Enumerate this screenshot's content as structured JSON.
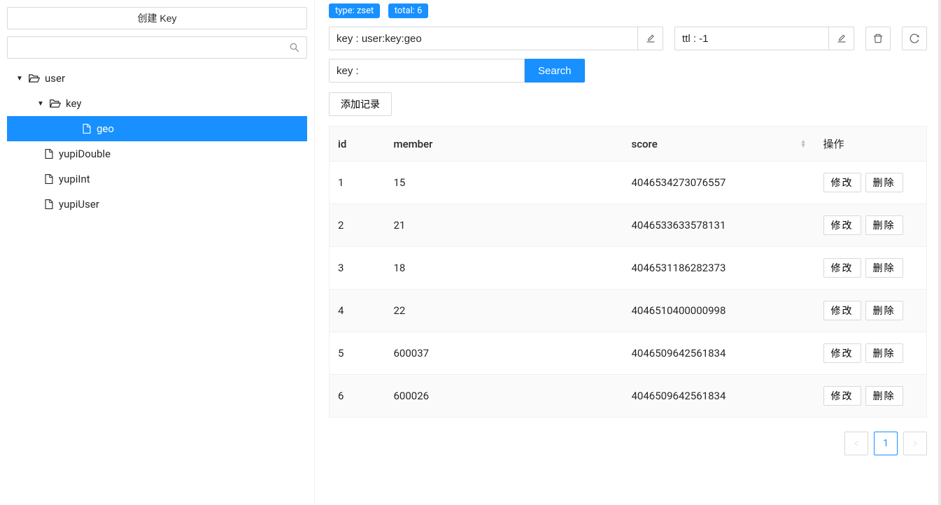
{
  "sidebar": {
    "create_label": "创建 Key",
    "search_placeholder": "",
    "tree": [
      {
        "label": "user",
        "type": "folder",
        "expanded": true,
        "level": 0
      },
      {
        "label": "key",
        "type": "folder",
        "expanded": true,
        "level": 1
      },
      {
        "label": "geo",
        "type": "file",
        "selected": true,
        "level": 2
      },
      {
        "label": "yupiDouble",
        "type": "file",
        "level": 1
      },
      {
        "label": "yupiInt",
        "type": "file",
        "level": 1
      },
      {
        "label": "yupiUser",
        "type": "file",
        "level": 1
      }
    ]
  },
  "main": {
    "type_tag": "type: zset",
    "total_tag": "total: 6",
    "key_value": "key : user:key:geo",
    "ttl_value": "ttl : -1",
    "search_prefix": "key : ",
    "search_button": "Search",
    "add_record": "添加记录",
    "columns": {
      "id": "id",
      "member": "member",
      "score": "score",
      "action": "操作"
    },
    "rows": [
      {
        "id": "1",
        "member": "15",
        "score": "4046534273076557"
      },
      {
        "id": "2",
        "member": "21",
        "score": "4046533633578131"
      },
      {
        "id": "3",
        "member": "18",
        "score": "4046531186282373"
      },
      {
        "id": "4",
        "member": "22",
        "score": "4046510400000998"
      },
      {
        "id": "5",
        "member": "600037",
        "score": "4046509642561834"
      },
      {
        "id": "6",
        "member": "600026",
        "score": "4046509642561834"
      }
    ],
    "edit_label": "修改",
    "delete_label": "删除",
    "page_current": "1"
  }
}
